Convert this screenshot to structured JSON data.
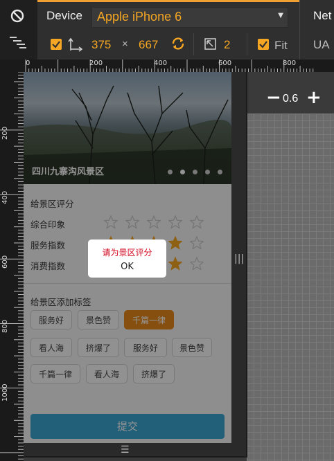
{
  "toolbar": {
    "device_label": "Device",
    "device_value": "Apple iPhone 6",
    "width": "375",
    "times": "×",
    "height": "667",
    "scale_value": "2",
    "fit_label": "Fit",
    "network_label": "Net",
    "ua_label": "UA",
    "accent": "#f5a623"
  },
  "ruler": {
    "top_labels": [
      "0",
      "200",
      "400",
      "600",
      "800"
    ],
    "left_labels": [
      "200",
      "400",
      "600",
      "800",
      "1000"
    ]
  },
  "zoom": {
    "minus": "−",
    "value": "0.6",
    "plus": "+"
  },
  "phone": {
    "banner_title": "四川九寨沟风景区",
    "rating_section_title": "给景区评分",
    "ratings": [
      {
        "label": "综合印象",
        "stars": 0
      },
      {
        "label": "服务指数",
        "stars": 4
      },
      {
        "label": "消费指数",
        "stars": 4
      }
    ],
    "tag_section_title": "给景区添加标签",
    "tags": [
      "服务好",
      "景色赞",
      "千篇一律",
      "看人海",
      "挤爆了",
      "服务好",
      "景色赞",
      "千篇一律",
      "看人海",
      "挤爆了"
    ],
    "selected_tag_index": 2,
    "submit_label": "提交",
    "dialog_message": "请为景区评分",
    "dialog_ok": "OK"
  }
}
